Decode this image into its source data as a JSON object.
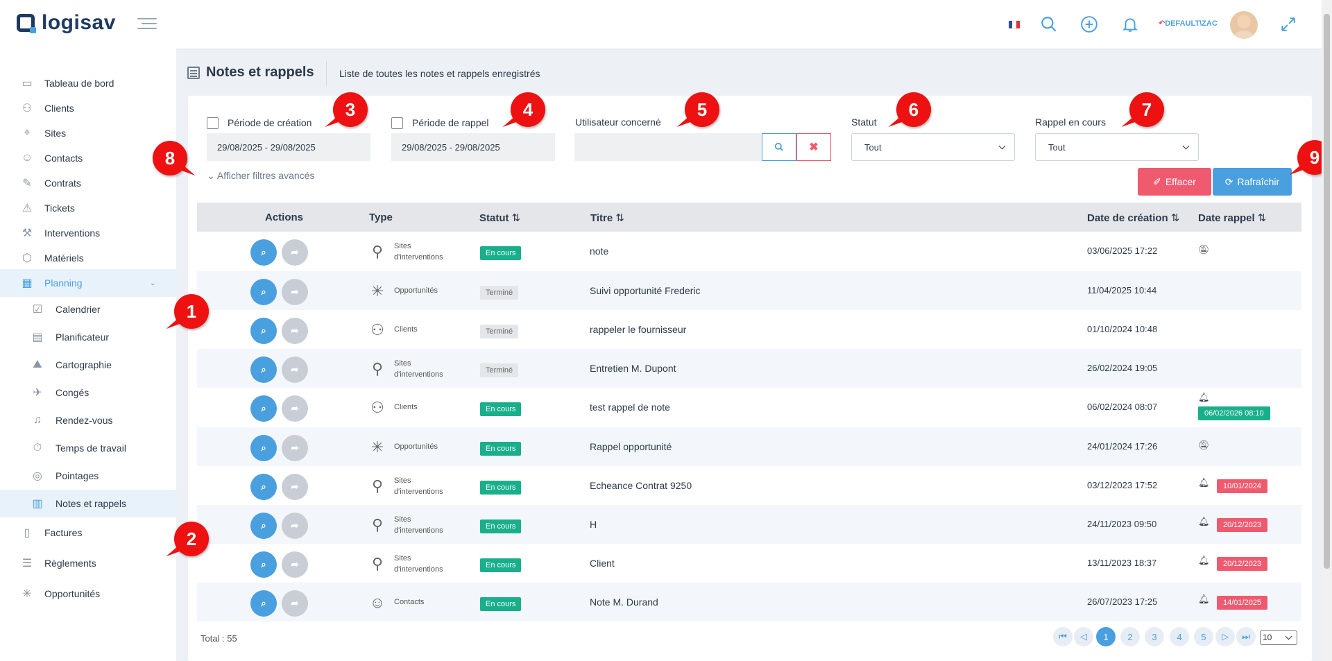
{
  "app": {
    "logo_text": "logisav"
  },
  "topbar": {
    "user_label": "DEFAULT\\ZAC",
    "icons": [
      "flag-fr-icon",
      "search-icon",
      "plus-circle-icon",
      "bell-icon",
      "user-return-icon",
      "avatar",
      "expand-icon"
    ]
  },
  "sidebar": {
    "items": [
      {
        "label": "Tableau de bord",
        "icon": "dashboard-icon"
      },
      {
        "label": "Clients",
        "icon": "users-icon"
      },
      {
        "label": "Sites",
        "icon": "location-icon"
      },
      {
        "label": "Contacts",
        "icon": "contact-icon"
      },
      {
        "label": "Contrats",
        "icon": "contract-icon"
      },
      {
        "label": "Tickets",
        "icon": "warning-icon"
      },
      {
        "label": "Interventions",
        "icon": "wrench-icon"
      },
      {
        "label": "Matériels",
        "icon": "box-icon"
      },
      {
        "label": "Planning",
        "icon": "calendar-icon"
      },
      {
        "label": "Factures",
        "icon": "invoice-icon"
      },
      {
        "label": "Règlements",
        "icon": "payment-icon"
      },
      {
        "label": "Opportunités",
        "icon": "network-icon"
      }
    ],
    "planning_sub": [
      {
        "label": "Calendrier"
      },
      {
        "label": "Planificateur"
      },
      {
        "label": "Cartographie"
      },
      {
        "label": "Congés"
      },
      {
        "label": "Rendez-vous"
      },
      {
        "label": "Temps de travail"
      },
      {
        "label": "Pointages"
      },
      {
        "label": "Notes et rappels"
      }
    ]
  },
  "page": {
    "title": "Notes et rappels",
    "subtitle": "Liste de toutes les notes et rappels enregistrés"
  },
  "filters": {
    "creation_label": "Période de création",
    "creation_value": "29/08/2025 - 29/08/2025",
    "rappel_label": "Période de rappel",
    "rappel_value": "29/08/2025 - 29/08/2025",
    "user_label": "Utilisateur concerné",
    "statut_label": "Statut",
    "statut_value": "Tout",
    "rappel_encours_label": "Rappel en cours",
    "rappel_encours_value": "Tout",
    "advanced": "Afficher filtres avancés",
    "effacer": "Effacer",
    "rafraichir": "Rafraîchir"
  },
  "table": {
    "headers": {
      "actions": "Actions",
      "type": "Type",
      "statut": "Statut",
      "titre": "Titre",
      "date_creation": "Date de création",
      "date_rappel": "Date rappel"
    },
    "rows": [
      {
        "type_l1": "Sites",
        "type_l2": "d'interventions",
        "icon": "location-pin-icon",
        "statut": "En cours",
        "titre": "note",
        "date": "03/06/2025 17:22",
        "rappel": "",
        "rappel_icon": "bell-off-icon",
        "rappel_color": ""
      },
      {
        "type_l1": "Opportunités",
        "type_l2": "",
        "icon": "network-icon",
        "statut": "Terminé",
        "titre": "Suivi opportunité Frederic",
        "date": "11/04/2025 10:44",
        "rappel": "",
        "rappel_icon": "",
        "rappel_color": ""
      },
      {
        "type_l1": "Clients",
        "type_l2": "",
        "icon": "users-icon",
        "statut": "Terminé",
        "titre": "rappeler le fournisseur",
        "date": "01/10/2024 10:48",
        "rappel": "",
        "rappel_icon": "",
        "rappel_color": ""
      },
      {
        "type_l1": "Sites",
        "type_l2": "d'interventions",
        "icon": "location-pin-icon",
        "statut": "Terminé",
        "titre": "Entretien M. Dupont",
        "date": "26/02/2024 19:05",
        "rappel": "",
        "rappel_icon": "",
        "rappel_color": ""
      },
      {
        "type_l1": "Clients",
        "type_l2": "",
        "icon": "users-icon",
        "statut": "En cours",
        "titre": "test rappel de note",
        "date": "06/02/2024 08:07",
        "rappel": "06/02/2026 08:10",
        "rappel_icon": "bell-icon",
        "rappel_color": "green"
      },
      {
        "type_l1": "Opportunités",
        "type_l2": "",
        "icon": "network-icon",
        "statut": "En cours",
        "titre": "Rappel opportunité",
        "date": "24/01/2024 17:26",
        "rappel": "",
        "rappel_icon": "bell-off-icon",
        "rappel_color": ""
      },
      {
        "type_l1": "Sites",
        "type_l2": "d'interventions",
        "icon": "location-pin-icon",
        "statut": "En cours",
        "titre": "Echeance Contrat 9250",
        "date": "03/12/2023 17:52",
        "rappel": "10/01/2024",
        "rappel_icon": "bell-icon",
        "rappel_color": "red"
      },
      {
        "type_l1": "Sites",
        "type_l2": "d'interventions",
        "icon": "location-pin-icon",
        "statut": "En cours",
        "titre": "H",
        "date": "24/11/2023 09:50",
        "rappel": "20/12/2023",
        "rappel_icon": "bell-icon",
        "rappel_color": "red"
      },
      {
        "type_l1": "Sites",
        "type_l2": "d'interventions",
        "icon": "location-pin-icon",
        "statut": "En cours",
        "titre": "Client",
        "date": "13/11/2023 18:37",
        "rappel": "20/12/2023",
        "rappel_icon": "bell-icon",
        "rappel_color": "red"
      },
      {
        "type_l1": "Contacts",
        "type_l2": "",
        "icon": "contact-icon",
        "statut": "En cours",
        "titre": "Note M. Durand",
        "date": "26/07/2023 17:25",
        "rappel": "14/01/2025",
        "rappel_icon": "bell-icon",
        "rappel_color": "red"
      }
    ]
  },
  "pagination": {
    "total": "Total : 55",
    "pages": [
      "1",
      "2",
      "3",
      "4",
      "5"
    ],
    "current": "1",
    "page_size": "10"
  },
  "annotations": [
    "1",
    "2",
    "3",
    "4",
    "5",
    "6",
    "7",
    "8",
    "9"
  ],
  "colors": {
    "accent": "#4a9fdf",
    "danger": "#ef5a6f",
    "success": "#1aaf8b",
    "annotation": "#ee1111"
  }
}
